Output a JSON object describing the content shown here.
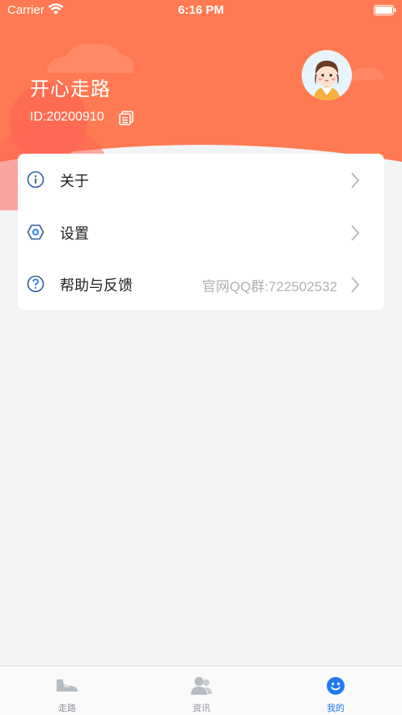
{
  "status_bar": {
    "carrier": "Carrier",
    "time": "6:16 PM"
  },
  "profile": {
    "name": "开心走路",
    "id_text": "ID:20200910"
  },
  "menu": {
    "items": [
      {
        "label": "关于",
        "extra": "",
        "icon": "info-icon"
      },
      {
        "label": "设置",
        "extra": "",
        "icon": "settings-icon"
      },
      {
        "label": "帮助与反馈",
        "extra": "官网QQ群:722502532",
        "icon": "help-icon"
      }
    ]
  },
  "tabs": [
    {
      "label": "走路",
      "icon": "shoe-icon",
      "active": false
    },
    {
      "label": "资讯",
      "icon": "users-icon",
      "active": false
    },
    {
      "label": "我的",
      "icon": "smile-icon",
      "active": true
    }
  ],
  "colors": {
    "header": "#ff7a52",
    "accent": "#1e7bf0",
    "menu_icon": "#2f5b9c"
  }
}
